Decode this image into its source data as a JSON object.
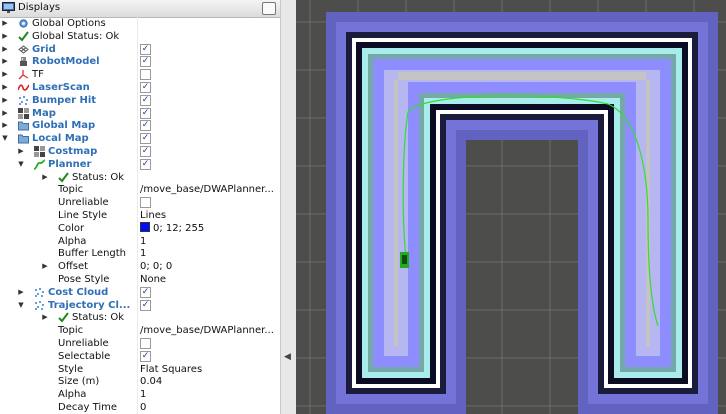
{
  "panel": {
    "title": "Displays",
    "rows": [
      {
        "label": "Global Options",
        "indent": 0,
        "icon": "gear-icon",
        "arrow": "right"
      },
      {
        "label": "Global Status: Ok",
        "indent": 0,
        "icon": "checkmark-icon",
        "arrow": "right"
      },
      {
        "label": "Grid",
        "indent": 0,
        "icon": "grid-icon",
        "arrow": "right",
        "display": true,
        "checked": true
      },
      {
        "label": "RobotModel",
        "indent": 0,
        "icon": "robot-icon",
        "arrow": "right",
        "display": true,
        "checked": true
      },
      {
        "label": "TF",
        "indent": 0,
        "icon": "tf-axes-icon",
        "arrow": "right",
        "checked": false
      },
      {
        "label": "LaserScan",
        "indent": 0,
        "icon": "laser-scan-icon",
        "arrow": "right",
        "display": true,
        "checked": true
      },
      {
        "label": "Bumper Hit",
        "indent": 0,
        "icon": "point-cloud-icon",
        "arrow": "right",
        "display": true,
        "checked": true
      },
      {
        "label": "Map",
        "indent": 0,
        "icon": "map-icon",
        "arrow": "right",
        "display": true,
        "checked": true
      },
      {
        "label": "Global Map",
        "indent": 0,
        "icon": "folder-icon",
        "arrow": "right",
        "display": true,
        "checked": true
      },
      {
        "label": "Local Map",
        "indent": 0,
        "icon": "folder-icon",
        "arrow": "down",
        "display": true,
        "checked": true
      },
      {
        "label": "Costmap",
        "indent": 1,
        "icon": "map-icon",
        "arrow": "right",
        "display": true,
        "checked": true
      },
      {
        "label": "Planner",
        "indent": 1,
        "icon": "path-icon",
        "arrow": "down",
        "display": true,
        "checked": true
      },
      {
        "label": "Status: Ok",
        "indent": 2,
        "icon": "checkmark-icon",
        "arrow": "right"
      },
      {
        "label": "Topic",
        "indent": 2,
        "value": "/move_base/DWAPlanner..."
      },
      {
        "label": "Unreliable",
        "indent": 2,
        "checked": false
      },
      {
        "label": "Line Style",
        "indent": 2,
        "value": "Lines"
      },
      {
        "label": "Color",
        "indent": 2,
        "value": "0; 12; 255",
        "swatch": true
      },
      {
        "label": "Alpha",
        "indent": 2,
        "value": "1"
      },
      {
        "label": "Buffer Length",
        "indent": 2,
        "value": "1"
      },
      {
        "label": "Offset",
        "indent": 2,
        "arrow": "right",
        "value": "0; 0; 0"
      },
      {
        "label": "Pose Style",
        "indent": 2,
        "value": "None"
      },
      {
        "label": "Cost Cloud",
        "indent": 1,
        "icon": "point-cloud-icon",
        "arrow": "right",
        "display": true,
        "checked": true
      },
      {
        "label": "Trajectory Cl...",
        "indent": 1,
        "icon": "point-cloud-icon",
        "arrow": "down",
        "display": true,
        "checked": true
      },
      {
        "label": "Status: Ok",
        "indent": 2,
        "icon": "checkmark-icon",
        "arrow": "right"
      },
      {
        "label": "Topic",
        "indent": 2,
        "value": "/move_base/DWAPlanner..."
      },
      {
        "label": "Unreliable",
        "indent": 2,
        "checked": false
      },
      {
        "label": "Selectable",
        "indent": 2,
        "checked": true
      },
      {
        "label": "Style",
        "indent": 2,
        "value": "Flat Squares"
      },
      {
        "label": "Size (m)",
        "indent": 2,
        "value": "0.04"
      },
      {
        "label": "Alpha",
        "indent": 2,
        "value": "1"
      },
      {
        "label": "Decay Time",
        "indent": 2,
        "value": "0"
      }
    ]
  },
  "colors": {
    "display_label": "#2f6fb6",
    "planner_color": "#000cff",
    "background": "#4d4e4b",
    "grid_line": "#6b6d69",
    "free_space": "#c4c4c4",
    "inflation": "#8d8dff",
    "inscribed": "#a8ecec",
    "obstacle": "#0b0b23",
    "plan_line": "#33dd33",
    "robot": "#22aa22"
  }
}
